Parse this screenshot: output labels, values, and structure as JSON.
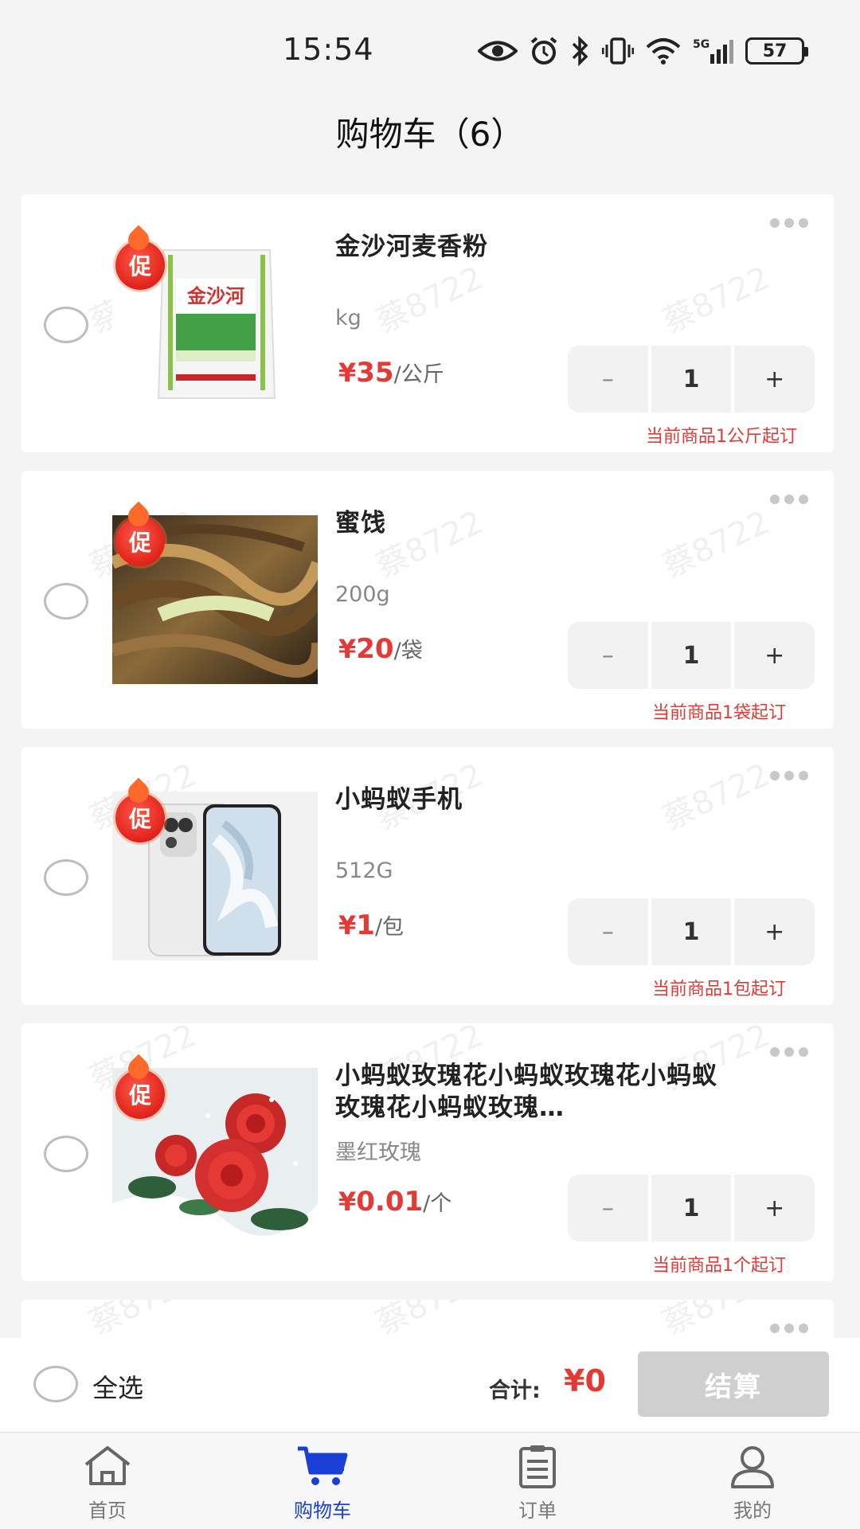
{
  "status_bar": {
    "time": "15:54",
    "battery": "57",
    "network": "5G"
  },
  "header": {
    "title": "购物车（6）"
  },
  "cart": {
    "items": [
      {
        "name": "金沙河麦香粉",
        "spec": "kg",
        "currency": "¥",
        "price": "35",
        "unit": "/公斤",
        "quantity": "1",
        "min_order": "当前商品1公斤起订",
        "promo": "促",
        "image_text": "金沙河"
      },
      {
        "name": "蜜饯",
        "spec": "200g",
        "currency": "¥",
        "price": "20",
        "unit": "/袋",
        "quantity": "1",
        "min_order": "当前商品1袋起订",
        "promo": "促"
      },
      {
        "name": "小蚂蚁手机",
        "spec": "512G",
        "currency": "¥",
        "price": "1",
        "unit": "/包",
        "quantity": "1",
        "min_order": "当前商品1包起订",
        "promo": "促"
      },
      {
        "name": "小蚂蚁玫瑰花小蚂蚁玫瑰花小蚂蚁玫瑰花小蚂蚁玫瑰…",
        "spec": "墨红玫瑰",
        "currency": "¥",
        "price": "0.01",
        "unit": "/个",
        "quantity": "1",
        "min_order": "当前商品1个起订",
        "promo": "促"
      }
    ],
    "stepper_minus": "–",
    "stepper_plus": "+"
  },
  "watermark": "蔡8722",
  "checkout": {
    "select_all": "全选",
    "total_label": "合计:",
    "total_value": "¥0",
    "button": "结算"
  },
  "tabs": [
    {
      "label": "首页",
      "icon": "home-icon"
    },
    {
      "label": "购物车",
      "icon": "cart-icon",
      "active": true
    },
    {
      "label": "订单",
      "icon": "order-icon"
    },
    {
      "label": "我的",
      "icon": "user-icon"
    }
  ],
  "colors": {
    "accent": "#1a3fd6",
    "price": "#e53935",
    "checkout_disabled": "#cfcfcf"
  }
}
